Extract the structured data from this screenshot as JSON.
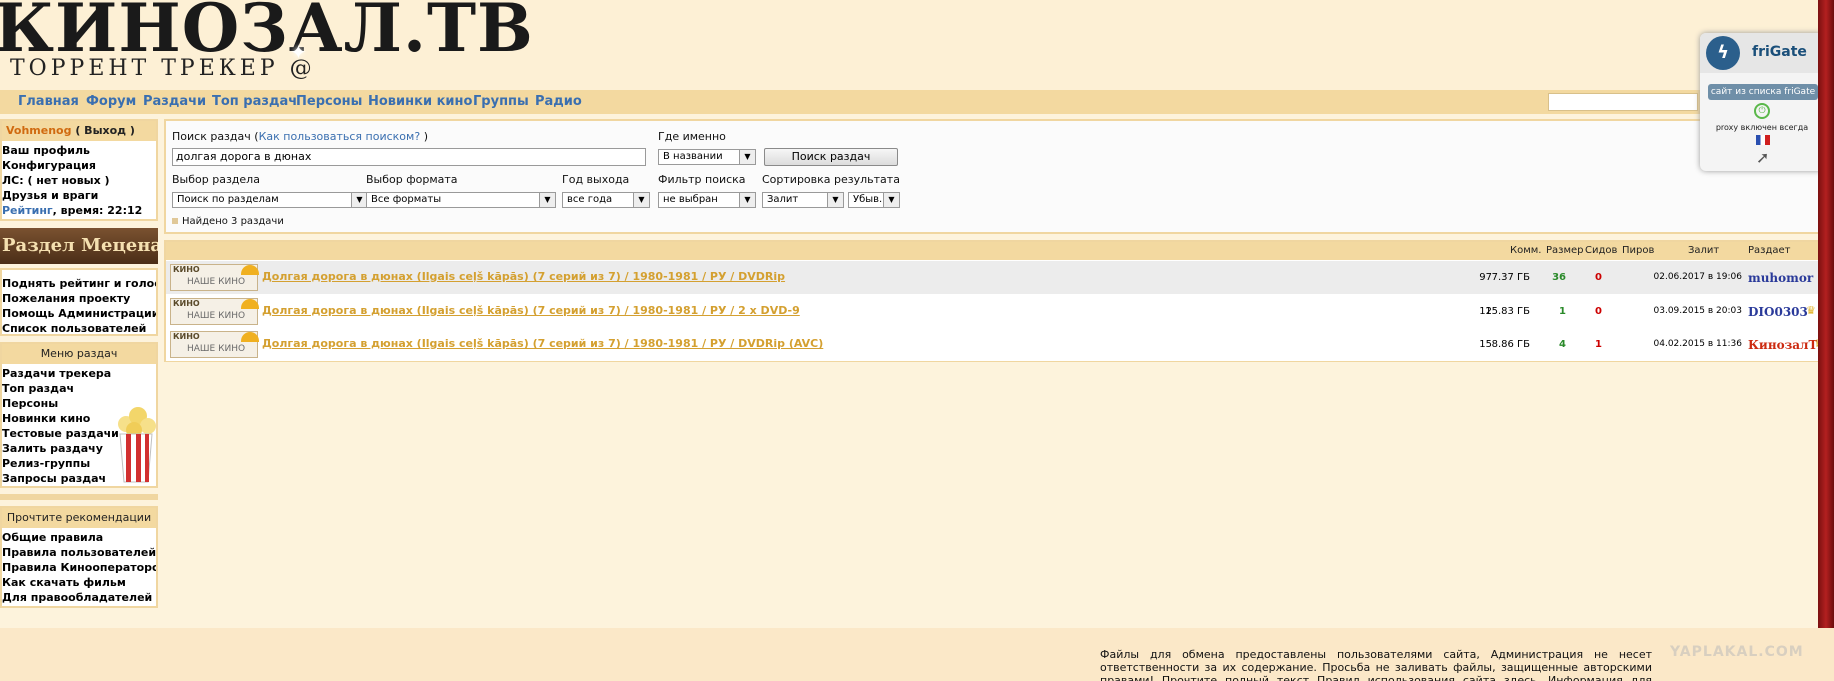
{
  "logo": {
    "title": "КИНОЗАЛ.ТВ",
    "subtitle": "ТОРРЕНТ ТРЕКЕР @"
  },
  "nav": {
    "items": [
      "Главная",
      "Форум",
      "Раздачи",
      "Топ раздач",
      "Персоны",
      "Новинки кино",
      "Группы",
      "Радио"
    ]
  },
  "user": {
    "name": "Vohmenog",
    "logout": "( Выход )",
    "profile": "Ваш профиль",
    "config": "Конфигурация",
    "pm": "ЛС: ( нет новых )",
    "friends": "Друзья и враги",
    "rating_link": "Рейтинг",
    "time": ", время: 22:12"
  },
  "mecenat": {
    "banner": "Раздел Меценатов",
    "items": [
      "Поднять рейтинг и голоса",
      "Пожелания проекту",
      "Помощь Администрации",
      "Список пользователей"
    ]
  },
  "menu": {
    "header": "Меню раздач",
    "items": [
      "Раздачи трекера",
      "Топ раздач",
      "Персоны",
      "Новинки кино",
      "Тестовые раздачи",
      "Залить раздачу",
      "Релиз-группы",
      "Запросы раздач"
    ]
  },
  "rec": {
    "header": "Прочтите рекомендации",
    "items": [
      "Общие правила",
      "Правила пользователей",
      "Правила Кинооператоров",
      "Как скачать фильм",
      "Для правообладателей"
    ]
  },
  "search": {
    "label": "Поиск раздач",
    "help_open": "(",
    "help_link": "Как пользоваться поиском?",
    "help_close": ")",
    "where_label": "Где именно",
    "query": "долгая дорога в дюнах",
    "where_value": "В названии",
    "button": "Поиск раздач",
    "section_label": "Выбор раздела",
    "section_value": "Поиск по разделам",
    "format_label": "Выбор формата",
    "format_value": "Все форматы",
    "year_label": "Год выхода",
    "year_value": "все года",
    "filter_label": "Фильтр поиска",
    "filter_value": "не выбран",
    "sort_label": "Сортировка результата",
    "sort_value": "Залит",
    "order_value": "Убыв.",
    "found": "Найдено 3 раздачи"
  },
  "table": {
    "headers": {
      "comments": "Комм.",
      "size": "Размер",
      "seeds": "Сидов",
      "peers": "Пиров",
      "added": "Залит",
      "uploader": "Раздает"
    },
    "rows": [
      {
        "cat_top": "КИНО",
        "cat": "НАШЕ КИНО",
        "title": "Долгая дорога в дюнах (Ilgais ceļš kāpās) (7 серий из 7) / 1980-1981 / РУ / DVDRip",
        "comments": "97",
        "size": "7.37 ГБ",
        "seeds": "36",
        "peers": "0",
        "added": "02.06.2017 в 19:06",
        "uploader": "muhomor",
        "uploader_color": "#2a3a9a"
      },
      {
        "cat_top": "КИНО",
        "cat": "НАШЕ КИНО",
        "title": "Долгая дорога в дюнах (Ilgais ceļš kāpās) (7 серий из 7) / 1980-1981 / РУ / 2 x DVD-9",
        "comments": "12",
        "size": "15.83 ГБ",
        "seeds": "1",
        "peers": "0",
        "added": "03.09.2015 в 20:03",
        "uploader": "DIO0303",
        "uploader_color": "#2a3a9a"
      },
      {
        "cat_top": "КИНО",
        "cat": "НАШЕ КИНО",
        "title": "Долгая дорога в дюнах (Ilgais ceļš kāpās) (7 серий из 7) / 1980-1981 / РУ / DVDRip (AVC)",
        "comments": "15",
        "size": "8.86 ГБ",
        "seeds": "4",
        "peers": "1",
        "added": "04.02.2015 в 11:36",
        "uploader": "КинозалТВ",
        "uploader_color": "#cc2a10"
      }
    ]
  },
  "frigate": {
    "name": "friGate",
    "button": "сайт из списка friGate",
    "status": "proxy включен всегда"
  },
  "footer": {
    "text": "Файлы для обмена предоставлены пользователями сайта, Администрация не несет ответственности за их содержание. Просьба не заливать файлы, защищенные авторскими правами! Прочтите полный текст Правил использования сайта здесь. Информация для правообладателей здесь!"
  },
  "watermark": "YAPLAKAL.COM",
  "colors": {
    "accent": "#f3d9a0",
    "link": "#3a6fb0",
    "title_link": "#d4a030",
    "seed": "#2a8a2a",
    "leech": "#cc0000"
  }
}
